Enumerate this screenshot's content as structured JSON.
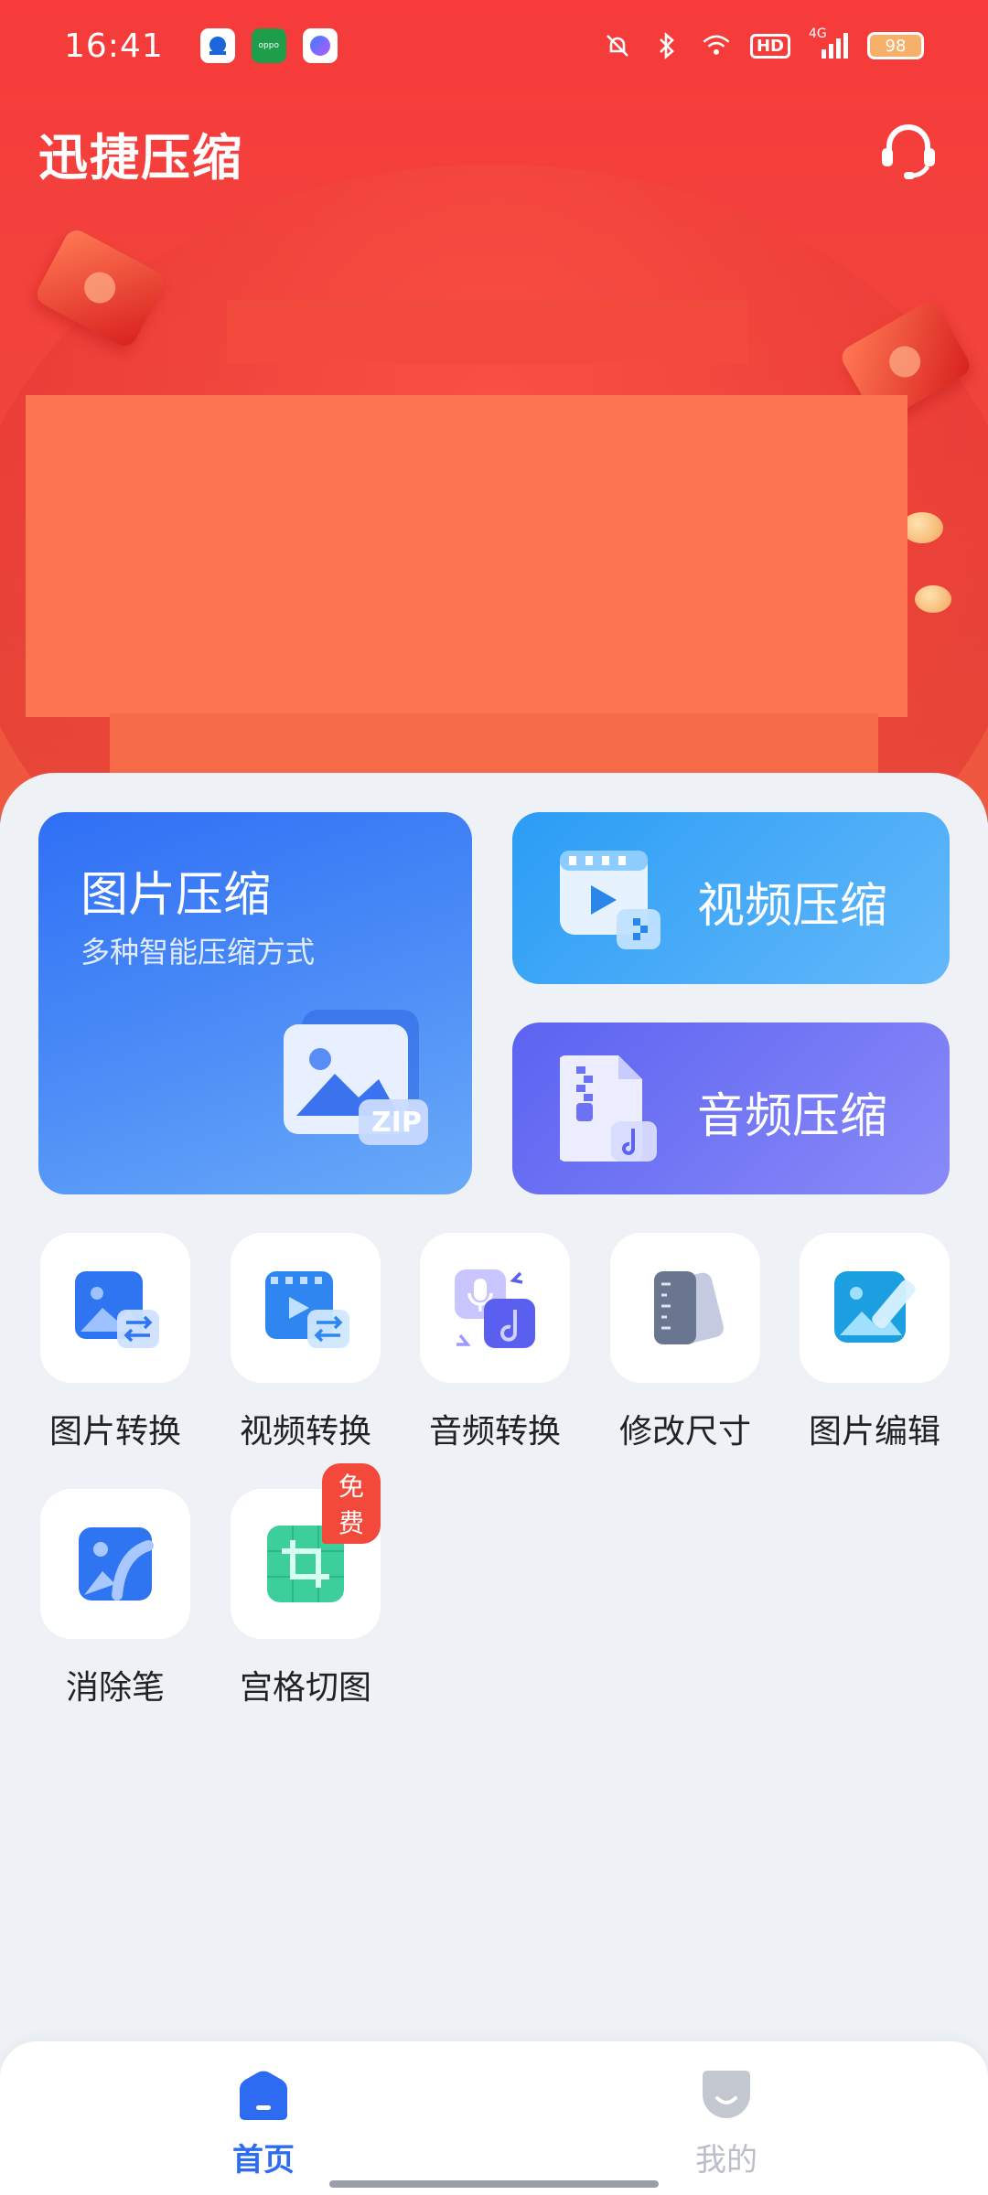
{
  "status_bar": {
    "time": "16:41",
    "battery": "98",
    "hd": "HD",
    "network": "4G",
    "icons": [
      "mute-bell-icon",
      "bluetooth-icon",
      "wifi-icon",
      "hd-icon",
      "signal-icon",
      "battery-icon"
    ],
    "notification_apps": [
      "app-notification-1",
      "oppo-notification",
      "assistant-notification"
    ],
    "oppo_label": "oppo"
  },
  "header": {
    "title": "迅捷压缩",
    "support_icon": "customer-service-icon"
  },
  "feature_cards": {
    "image": {
      "title": "图片压缩",
      "subtitle": "多种智能压缩方式",
      "badge": "ZIP"
    },
    "video": {
      "title": "视频压缩"
    },
    "audio": {
      "title": "音频压缩"
    }
  },
  "tools": [
    {
      "label": "图片转换",
      "icon": "image-convert-icon"
    },
    {
      "label": "视频转换",
      "icon": "video-convert-icon"
    },
    {
      "label": "音频转换",
      "icon": "audio-convert-icon"
    },
    {
      "label": "修改尺寸",
      "icon": "resize-icon"
    },
    {
      "label": "图片编辑",
      "icon": "image-edit-icon"
    },
    {
      "label": "消除笔",
      "icon": "eraser-pen-icon"
    },
    {
      "label": "宫格切图",
      "icon": "grid-crop-icon",
      "badge": "免费"
    }
  ],
  "bottom_nav": [
    {
      "label": "首页",
      "icon": "home-icon",
      "active": true
    },
    {
      "label": "我的",
      "icon": "profile-icon",
      "active": false
    }
  ],
  "colors": {
    "brand_red": "#f73b3b",
    "primary_blue": "#2d6bf3",
    "audio_purple": "#5b63f1",
    "badge_red": "#f2493b"
  }
}
